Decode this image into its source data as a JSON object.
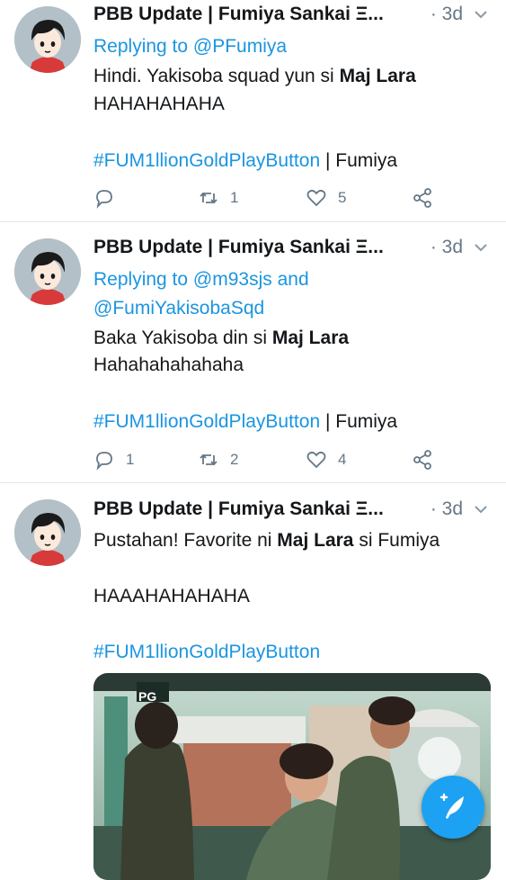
{
  "colors": {
    "accent": "#1b95e0",
    "secondary_text": "#657786",
    "fab": "#1da1f2"
  },
  "tweets": [
    {
      "author": "PBB Update | Fumiya Sankai Ξ...",
      "time": "· 3d",
      "reply_prefix": "Replying to ",
      "reply_handle": "@PFumiya",
      "body_line1_pre": "Hindi. Yakisoba squad yun si ",
      "body_line1_bold": "Maj Lara",
      "body_line2": "HAHAHAHAHA",
      "hashtag": "#FUM1llionGoldPlayButton",
      "hashtag_suffix": " | Fumiya",
      "replies": "",
      "retweets": "1",
      "likes": "5"
    },
    {
      "author": "PBB Update | Fumiya Sankai Ξ...",
      "time": "· 3d",
      "reply_prefix": "Replying to ",
      "reply_handle": "@m93sjs",
      "reply_and": " and",
      "reply_handle2": "@FumiYakisobaSqd",
      "body_line1_pre": "Baka Yakisoba din si ",
      "body_line1_bold": "Maj Lara",
      "body_line2": "Hahahahahahaha",
      "hashtag": "#FUM1llionGoldPlayButton",
      "hashtag_suffix": " | Fumiya",
      "replies": "1",
      "retweets": "2",
      "likes": "4"
    },
    {
      "author": "PBB Update | Fumiya Sankai Ξ...",
      "time": "· 3d",
      "body_line1_pre": "Pustahan! Favorite ni ",
      "body_line1_bold": "Maj Lara",
      "body_line1_post": " si Fumiya",
      "body_line2": "HAAAHAHAHAHA",
      "hashtag": "#FUM1llionGoldPlayButton",
      "media_badge": "PG"
    }
  ],
  "icons": {
    "reply": "reply-icon",
    "retweet": "retweet-icon",
    "like": "heart-icon",
    "share": "share-icon",
    "more": "chevron-down-icon",
    "compose": "compose-tweet-icon"
  }
}
